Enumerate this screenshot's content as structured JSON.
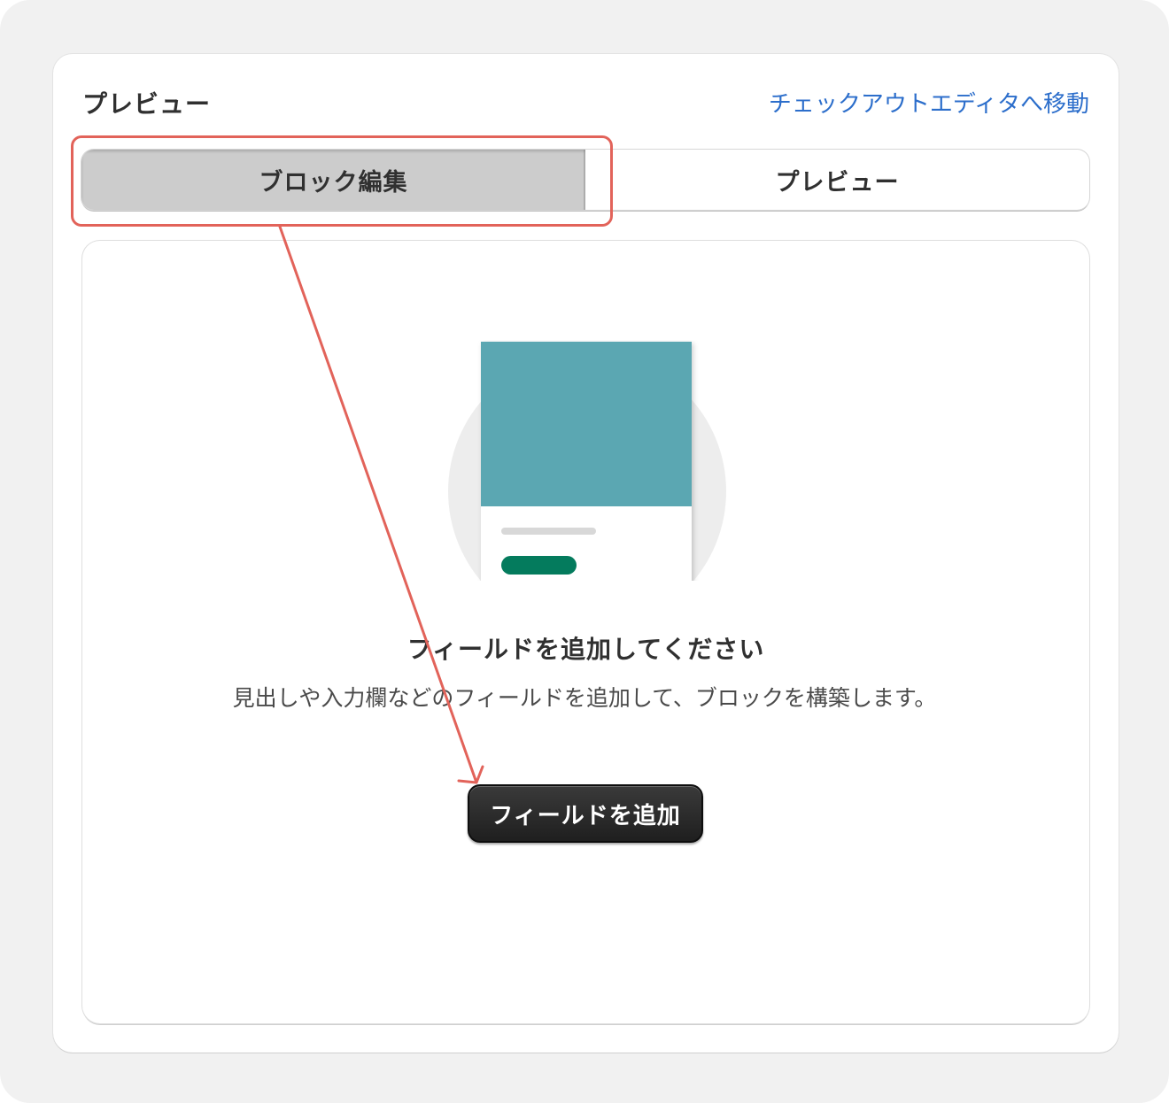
{
  "card": {
    "title": "プレビュー",
    "editor_link": "チェックアウトエディタへ移動"
  },
  "tabs": [
    {
      "label": "ブロック編集",
      "selected": true
    },
    {
      "label": "プレビュー",
      "selected": false
    }
  ],
  "empty_state": {
    "heading": "フィールドを追加してください",
    "body": "見出しや入力欄などのフィールドを追加して、ブロックを構築します。",
    "button_label": "フィールドを追加"
  },
  "colors": {
    "link": "#2c6ecb",
    "annotation": "#e2635a",
    "illustration_teal": "#5ba7b2",
    "illustration_green": "#047b5d",
    "button_dark": "#2a2a2a"
  }
}
